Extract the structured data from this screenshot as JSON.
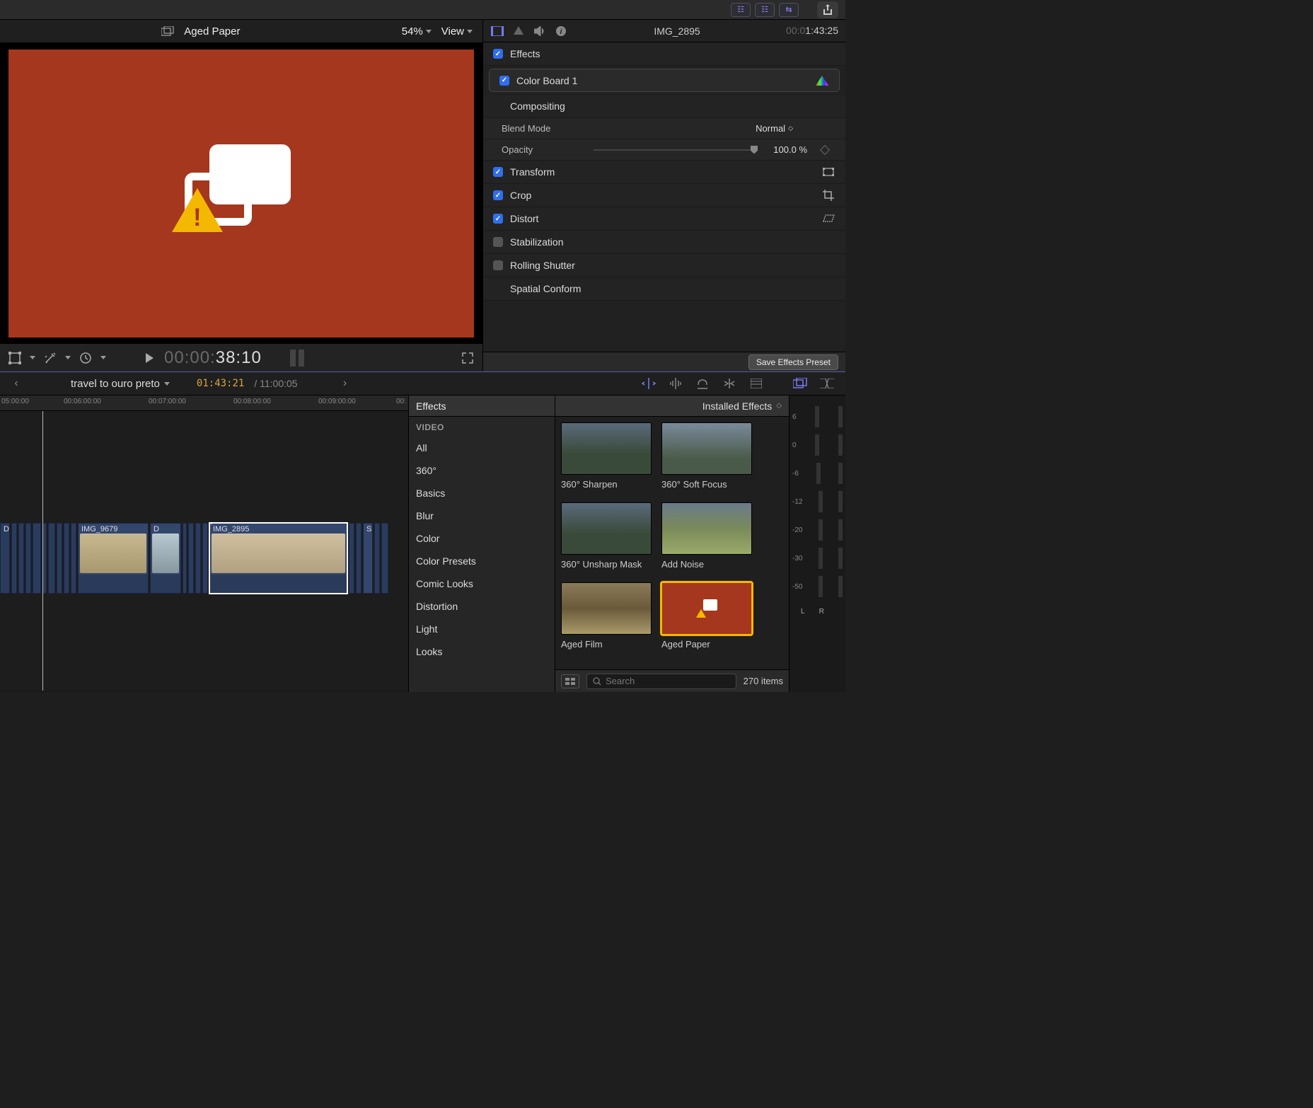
{
  "toolbar": {
    "share": "share"
  },
  "viewer": {
    "title": "Aged Paper",
    "zoom": "54%",
    "view_label": "View"
  },
  "transport": {
    "timecode_dim": "00:00:",
    "timecode_bright": "38:10"
  },
  "inspector": {
    "clip_name": "IMG_2895",
    "timecode_dim": "00:0",
    "timecode_bright": "1:43:25",
    "effects_label": "Effects",
    "color_board_label": "Color Board 1",
    "compositing_label": "Compositing",
    "blend_mode_label": "Blend Mode",
    "blend_mode_value": "Normal",
    "opacity_label": "Opacity",
    "opacity_value": "100.0",
    "opacity_unit": "%",
    "transform_label": "Transform",
    "crop_label": "Crop",
    "distort_label": "Distort",
    "stabilization_label": "Stabilization",
    "rolling_shutter_label": "Rolling Shutter",
    "spatial_conform_label": "Spatial Conform",
    "save_preset_label": "Save Effects Preset"
  },
  "project": {
    "name": "travel to ouro preto",
    "timecode": "01:43:21",
    "sep": " / ",
    "duration": "11:00:05"
  },
  "timeline": {
    "ticks": [
      "05:00:00",
      "00:06:00:00",
      "00:07:00:00",
      "00:08:00:00",
      "00:09:00:00",
      "00:"
    ],
    "clip1_label": "D",
    "clip2_label": "IMG_9679",
    "clip3_label": "D",
    "clip4_label": "IMG_2895",
    "clip5_label": "S"
  },
  "effects": {
    "header": "Effects",
    "installed_label": "Installed Effects",
    "video_header": "VIDEO",
    "categories": [
      "All",
      "360°",
      "Basics",
      "Blur",
      "Color",
      "Color Presets",
      "Comic Looks",
      "Distortion",
      "Light",
      "Looks"
    ],
    "items": [
      {
        "label": "360° Sharpen"
      },
      {
        "label": "360° Soft Focus"
      },
      {
        "label": "360° Unsharp Mask"
      },
      {
        "label": "Add Noise"
      },
      {
        "label": "Aged Film"
      },
      {
        "label": "Aged Paper"
      }
    ],
    "search_placeholder": "Search",
    "count_label": "270 items"
  },
  "meters": {
    "scale": [
      "6",
      "0",
      "-6",
      "-12",
      "-20",
      "-30",
      "-50"
    ],
    "left": "L",
    "right": "R"
  }
}
